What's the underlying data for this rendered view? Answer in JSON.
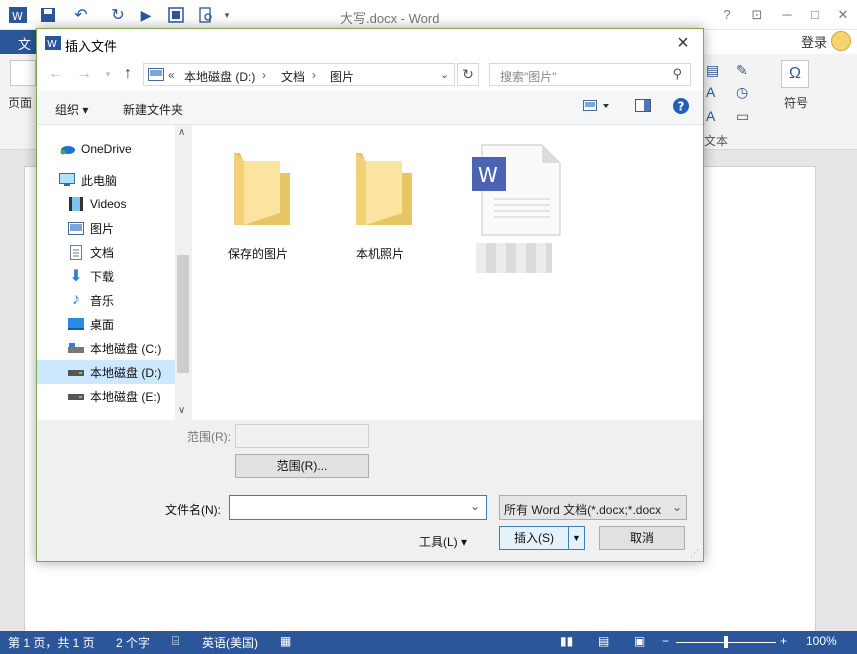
{
  "window": {
    "title": "大写.docx - Word",
    "ribbon": {
      "file_tab": "文件",
      "login": "登录",
      "left_btn": "页面",
      "group_label": "文本",
      "symbol": "符号"
    }
  },
  "statusbar": {
    "page": "第 1 页，共 1 页",
    "words": "2 个字",
    "language": "英语(美国)",
    "zoom": "100%"
  },
  "dialog": {
    "title": "插入文件",
    "address": {
      "prefix": "«",
      "crumbs": [
        "本地磁盘 (D:)",
        "文档",
        "图片"
      ]
    },
    "search_placeholder": "搜索\"图片\"",
    "toolbar": {
      "organize": "组织",
      "new_folder": "新建文件夹"
    },
    "nav_items": [
      {
        "label": "OneDrive",
        "icon": "onedrive-icon"
      },
      {
        "label": "此电脑",
        "icon": "computer-icon"
      },
      {
        "label": "Videos",
        "icon": "video-icon"
      },
      {
        "label": "图片",
        "icon": "picture-icon"
      },
      {
        "label": "文档",
        "icon": "document-icon"
      },
      {
        "label": "下载",
        "icon": "download-icon"
      },
      {
        "label": "音乐",
        "icon": "music-icon"
      },
      {
        "label": "桌面",
        "icon": "desktop-icon"
      },
      {
        "label": "本地磁盘 (C:)",
        "icon": "drive-icon"
      },
      {
        "label": "本地磁盘 (D:)",
        "icon": "drive-icon",
        "selected": true
      },
      {
        "label": "本地磁盘 (E:)",
        "icon": "drive-icon"
      }
    ],
    "files": [
      {
        "name": "保存的图片",
        "type": "folder"
      },
      {
        "name": "本机照片",
        "type": "folder"
      },
      {
        "name": "",
        "type": "word-document"
      }
    ],
    "range_label": "范围(R):",
    "range_button": "范围(R)...",
    "filename_label": "文件名(N):",
    "filename_value": "",
    "filetype_value": "所有 Word 文档(*.docx;*.docx",
    "tools": "工具(L)",
    "insert": "插入(S)",
    "cancel": "取消"
  },
  "colors": {
    "word_blue": "#2b579a",
    "selected": "#cce8ff",
    "folder": "#f3d179",
    "dialog_border": "#7fa94a"
  }
}
